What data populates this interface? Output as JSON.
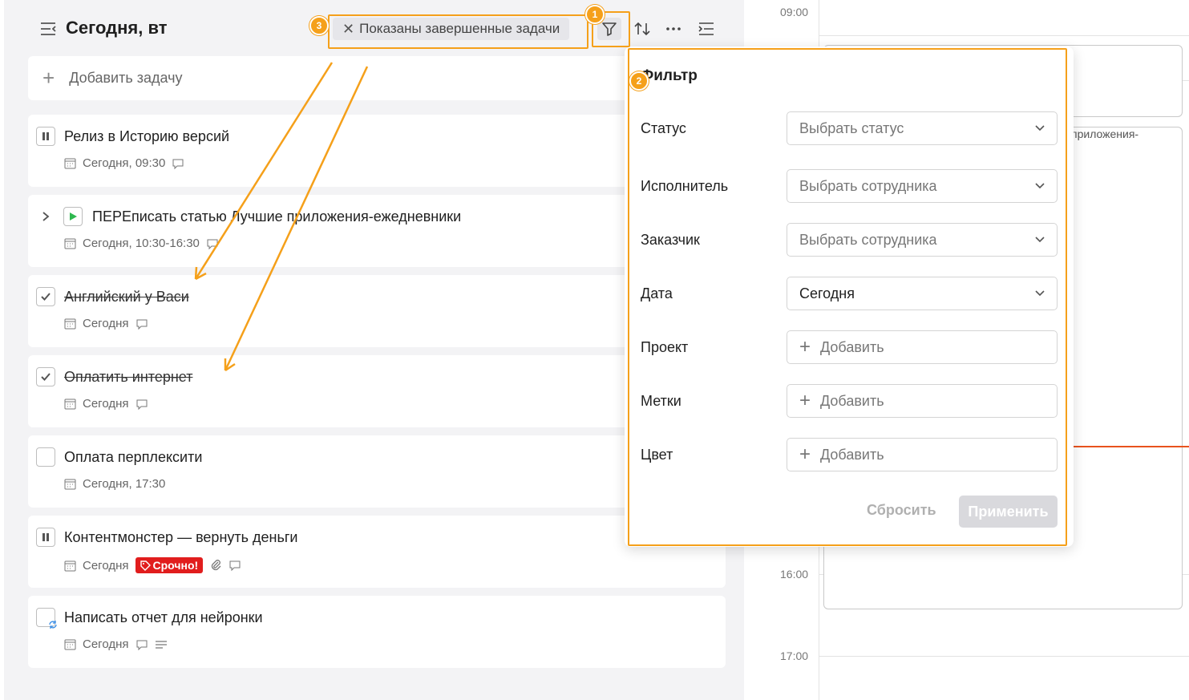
{
  "header": {
    "title": "Сегодня, вт",
    "filter_chip": "Показаны завершенные задачи"
  },
  "add_task": {
    "label": "Добавить задачу"
  },
  "tasks": [
    {
      "title": "Релиз в Историю версий",
      "date": "Сегодня, 09:30",
      "state": "paused",
      "done": false
    },
    {
      "title": "ПЕРЕписать статью Лучшие приложения-ежедневники",
      "date": "Сегодня, 10:30-16:30",
      "state": "playing",
      "done": false
    },
    {
      "title": "Английский у Васи",
      "date": "Сегодня",
      "state": "done",
      "done": true
    },
    {
      "title": "Оплатить интернет",
      "date": "Сегодня",
      "state": "done",
      "done": true
    },
    {
      "title": "Оплата перплексити",
      "date": "Сегодня, 17:30",
      "state": "open",
      "done": false
    },
    {
      "title": "Контентмонстер — вернуть деньги",
      "date": "Сегодня",
      "state": "paused",
      "done": false,
      "tag": "Срочно!"
    },
    {
      "title": "Написать отчет для нейронки",
      "date": "Сегодня",
      "state": "recurring",
      "done": false
    }
  ],
  "calendar": {
    "times": [
      "09:00",
      "16:00",
      "17:00"
    ],
    "event_snippet": "приложения-"
  },
  "filter": {
    "title": "Фильтр",
    "fields": [
      {
        "label": "Статус",
        "value": "Выбрать статус",
        "kind": "select"
      },
      {
        "label": "Исполнитель",
        "value": "Выбрать сотрудника",
        "kind": "select"
      },
      {
        "label": "Заказчик",
        "value": "Выбрать сотрудника",
        "kind": "select"
      },
      {
        "label": "Дата",
        "value": "Сегодня",
        "kind": "select-value"
      },
      {
        "label": "Проект",
        "value": "Добавить",
        "kind": "add"
      },
      {
        "label": "Метки",
        "value": "Добавить",
        "kind": "add"
      },
      {
        "label": "Цвет",
        "value": "Добавить",
        "kind": "add"
      }
    ],
    "reset_label": "Сбросить",
    "apply_label": "Применить"
  },
  "annotations": {
    "badge1": "1",
    "badge2": "2",
    "badge3": "3"
  },
  "colors": {
    "accent_annotation": "#f5a01a",
    "urgent": "#e11d1d",
    "now_line": "#e8531e",
    "play": "#2eb84f"
  }
}
